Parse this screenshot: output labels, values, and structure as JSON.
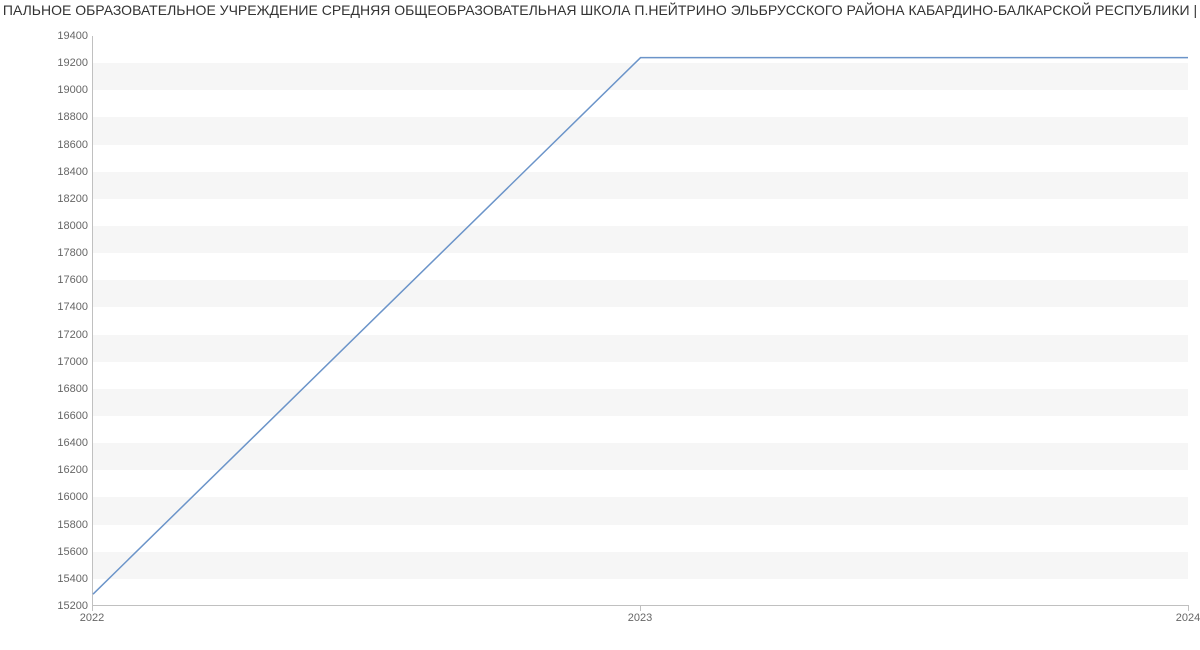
{
  "chart_data": {
    "type": "line",
    "title": "ПАЛЬНОЕ ОБРАЗОВАТЕЛЬНОЕ УЧРЕЖДЕНИЕ СРЕДНЯЯ ОБЩЕОБРАЗОВАТЕЛЬНАЯ ШКОЛА П.НЕЙТРИНО ЭЛЬБРУССКОГО РАЙОНА КАБАРДИНО-БАЛКАРСКОЙ РЕСПУБЛИКИ |",
    "x": [
      2022,
      2023,
      2024
    ],
    "values": [
      15280,
      19240,
      19240
    ],
    "xlim": [
      2022,
      2024
    ],
    "ylim": [
      15200,
      19400
    ],
    "y_ticks": [
      15200,
      15400,
      15600,
      15800,
      16000,
      16200,
      16400,
      16600,
      16800,
      17000,
      17200,
      17400,
      17600,
      17800,
      18000,
      18200,
      18400,
      18600,
      18800,
      19000,
      19200,
      19400
    ],
    "x_ticks": [
      2022,
      2023,
      2024
    ],
    "xlabel": "",
    "ylabel": "",
    "line_color": "#6b94c9"
  }
}
